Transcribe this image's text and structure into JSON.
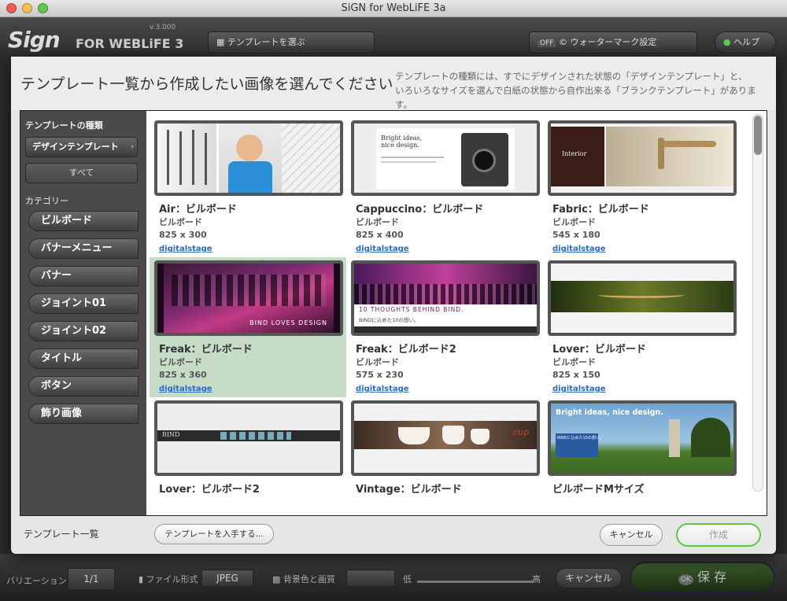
{
  "window": {
    "title": "SiGN for WebLiFE 3a"
  },
  "app": {
    "logo": "Sign",
    "logo_sub": "FOR WEBLiFE 3",
    "version": "v.3.000",
    "template_select": "テンプレートを選ぶ",
    "watermark_toggle": "OFF",
    "watermark_label": "ウォーターマーク設定",
    "help_label": "ヘルプ"
  },
  "dialog": {
    "title": "テンプレート一覧から作成したい画像を選んでください",
    "description_line1": "テンプレートの種類には、すでにデザインされた状態の「デザインテンプレート」と、",
    "description_line2": "いろいろなサイズを選んで白紙の状態から自作出来る「ブランクテンプレート」があります。",
    "sidebar": {
      "type_heading": "テンプレートの種類",
      "type_selected": "デザインテンプレート",
      "all_label": "すべて",
      "category_heading": "カテゴリー",
      "categories": [
        "ビルボード",
        "バナーメニュー",
        "バナー",
        "ジョイント01",
        "ジョイント02",
        "タイトル",
        "ボタン",
        "飾り画像"
      ]
    },
    "templates": [
      {
        "name": "Air：ビルボード",
        "type": "ビルボード",
        "size": "825 x 300",
        "author": "digitalstage"
      },
      {
        "name": "Cappuccino：ビルボード",
        "type": "ビルボード",
        "size": "825 x 400",
        "author": "digitalstage",
        "thumb_text": "Bright ideas, nice design."
      },
      {
        "name": "Fabric：ビルボード",
        "type": "ビルボード",
        "size": "545 x 180",
        "author": "digitalstage",
        "thumb_text": "Interior"
      },
      {
        "name": "Freak：ビルボード",
        "type": "ビルボード",
        "size": "825 x 360",
        "author": "digitalstage",
        "thumb_text": "BIND LOVES DESIGN"
      },
      {
        "name": "Freak：ビルボード2",
        "type": "ビルボード",
        "size": "575 x 230",
        "author": "digitalstage",
        "thumb_text": "10 THOUGHTS BEHIND BIND.",
        "thumb_sub": "BINDに込めた10の想い。"
      },
      {
        "name": "Lover：ビルボード",
        "type": "ビルボード",
        "size": "825 x 150",
        "author": "digitalstage"
      },
      {
        "name": "Lover：ビルボード2",
        "type": "",
        "size": "",
        "author": "",
        "thumb_text": "BIND"
      },
      {
        "name": "Vintage：ビルボード",
        "type": "",
        "size": "",
        "author": "",
        "thumb_text": "cup"
      },
      {
        "name": "ビルボードMサイズ",
        "type": "",
        "size": "",
        "author": "",
        "thumb_text": "Bright ideas, nice design.",
        "thumb_sub": "BINDに込めた10の想い。"
      }
    ],
    "footer_label": "テンプレート一覧",
    "get_templates_button": "テンプレートを入手する...",
    "cancel_button": "キャンセル",
    "create_button": "作成"
  },
  "bottom_bar": {
    "variation_label": "バリエーション",
    "variation_value": "1/1",
    "file_format_label": "ファイル形式",
    "file_format_value": "JPEG",
    "background_label": "背景色と画質",
    "quality_low": "低",
    "quality_high": "高",
    "cancel_label": "キャンセル",
    "save_label": "保 存",
    "ok_badge": "OK"
  }
}
